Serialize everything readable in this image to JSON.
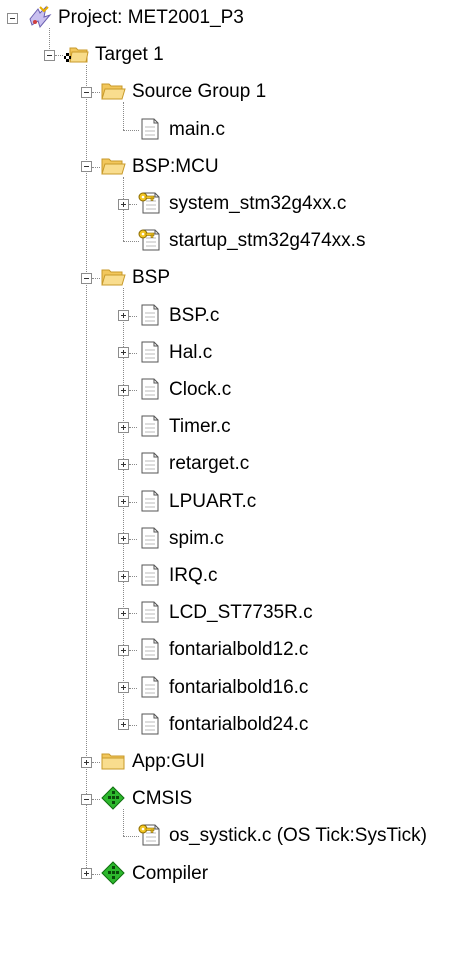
{
  "project": {
    "label": "Project: MET2001_P3",
    "expanded": true,
    "icon": "project-icon",
    "children": [
      {
        "label": "Target 1",
        "expanded": true,
        "icon": "target-icon",
        "children": [
          {
            "label": "Source Group 1",
            "expanded": true,
            "icon": "folder-icon",
            "children": [
              {
                "label": "main.c",
                "icon": "file-icon"
              }
            ]
          },
          {
            "label": "BSP:MCU",
            "expanded": true,
            "icon": "folder-icon",
            "children": [
              {
                "label": "system_stm32g4xx.c",
                "icon": "file-key-icon",
                "expandable": true
              },
              {
                "label": "startup_stm32g474xx.s",
                "icon": "file-key-icon"
              }
            ]
          },
          {
            "label": "BSP",
            "expanded": true,
            "icon": "folder-icon",
            "children": [
              {
                "label": "BSP.c",
                "icon": "file-icon",
                "expandable": true
              },
              {
                "label": "Hal.c",
                "icon": "file-icon",
                "expandable": true
              },
              {
                "label": "Clock.c",
                "icon": "file-icon",
                "expandable": true
              },
              {
                "label": "Timer.c",
                "icon": "file-icon",
                "expandable": true
              },
              {
                "label": "retarget.c",
                "icon": "file-icon",
                "expandable": true
              },
              {
                "label": "LPUART.c",
                "icon": "file-icon",
                "expandable": true
              },
              {
                "label": "spim.c",
                "icon": "file-icon",
                "expandable": true
              },
              {
                "label": "IRQ.c",
                "icon": "file-icon",
                "expandable": true
              },
              {
                "label": "LCD_ST7735R.c",
                "icon": "file-icon",
                "expandable": true
              },
              {
                "label": "fontarialbold12.c",
                "icon": "file-icon",
                "expandable": true
              },
              {
                "label": "fontarialbold16.c",
                "icon": "file-icon",
                "expandable": true
              },
              {
                "label": "fontarialbold24.c",
                "icon": "file-icon",
                "expandable": true
              }
            ]
          },
          {
            "label": "App:GUI",
            "expanded": false,
            "icon": "folder-closed-icon",
            "children": []
          },
          {
            "label": "CMSIS",
            "expanded": true,
            "icon": "component-icon",
            "children": [
              {
                "label": "os_systick.c (OS Tick:SysTick)",
                "icon": "file-key-icon"
              }
            ]
          },
          {
            "label": "Compiler",
            "expanded": false,
            "icon": "component-icon",
            "children": []
          }
        ]
      }
    ]
  },
  "colors": {
    "folder": "#f2c75c",
    "folder_dark": "#c89a2a",
    "component": "#2db82d",
    "tree_line": "#8a8a8a"
  }
}
